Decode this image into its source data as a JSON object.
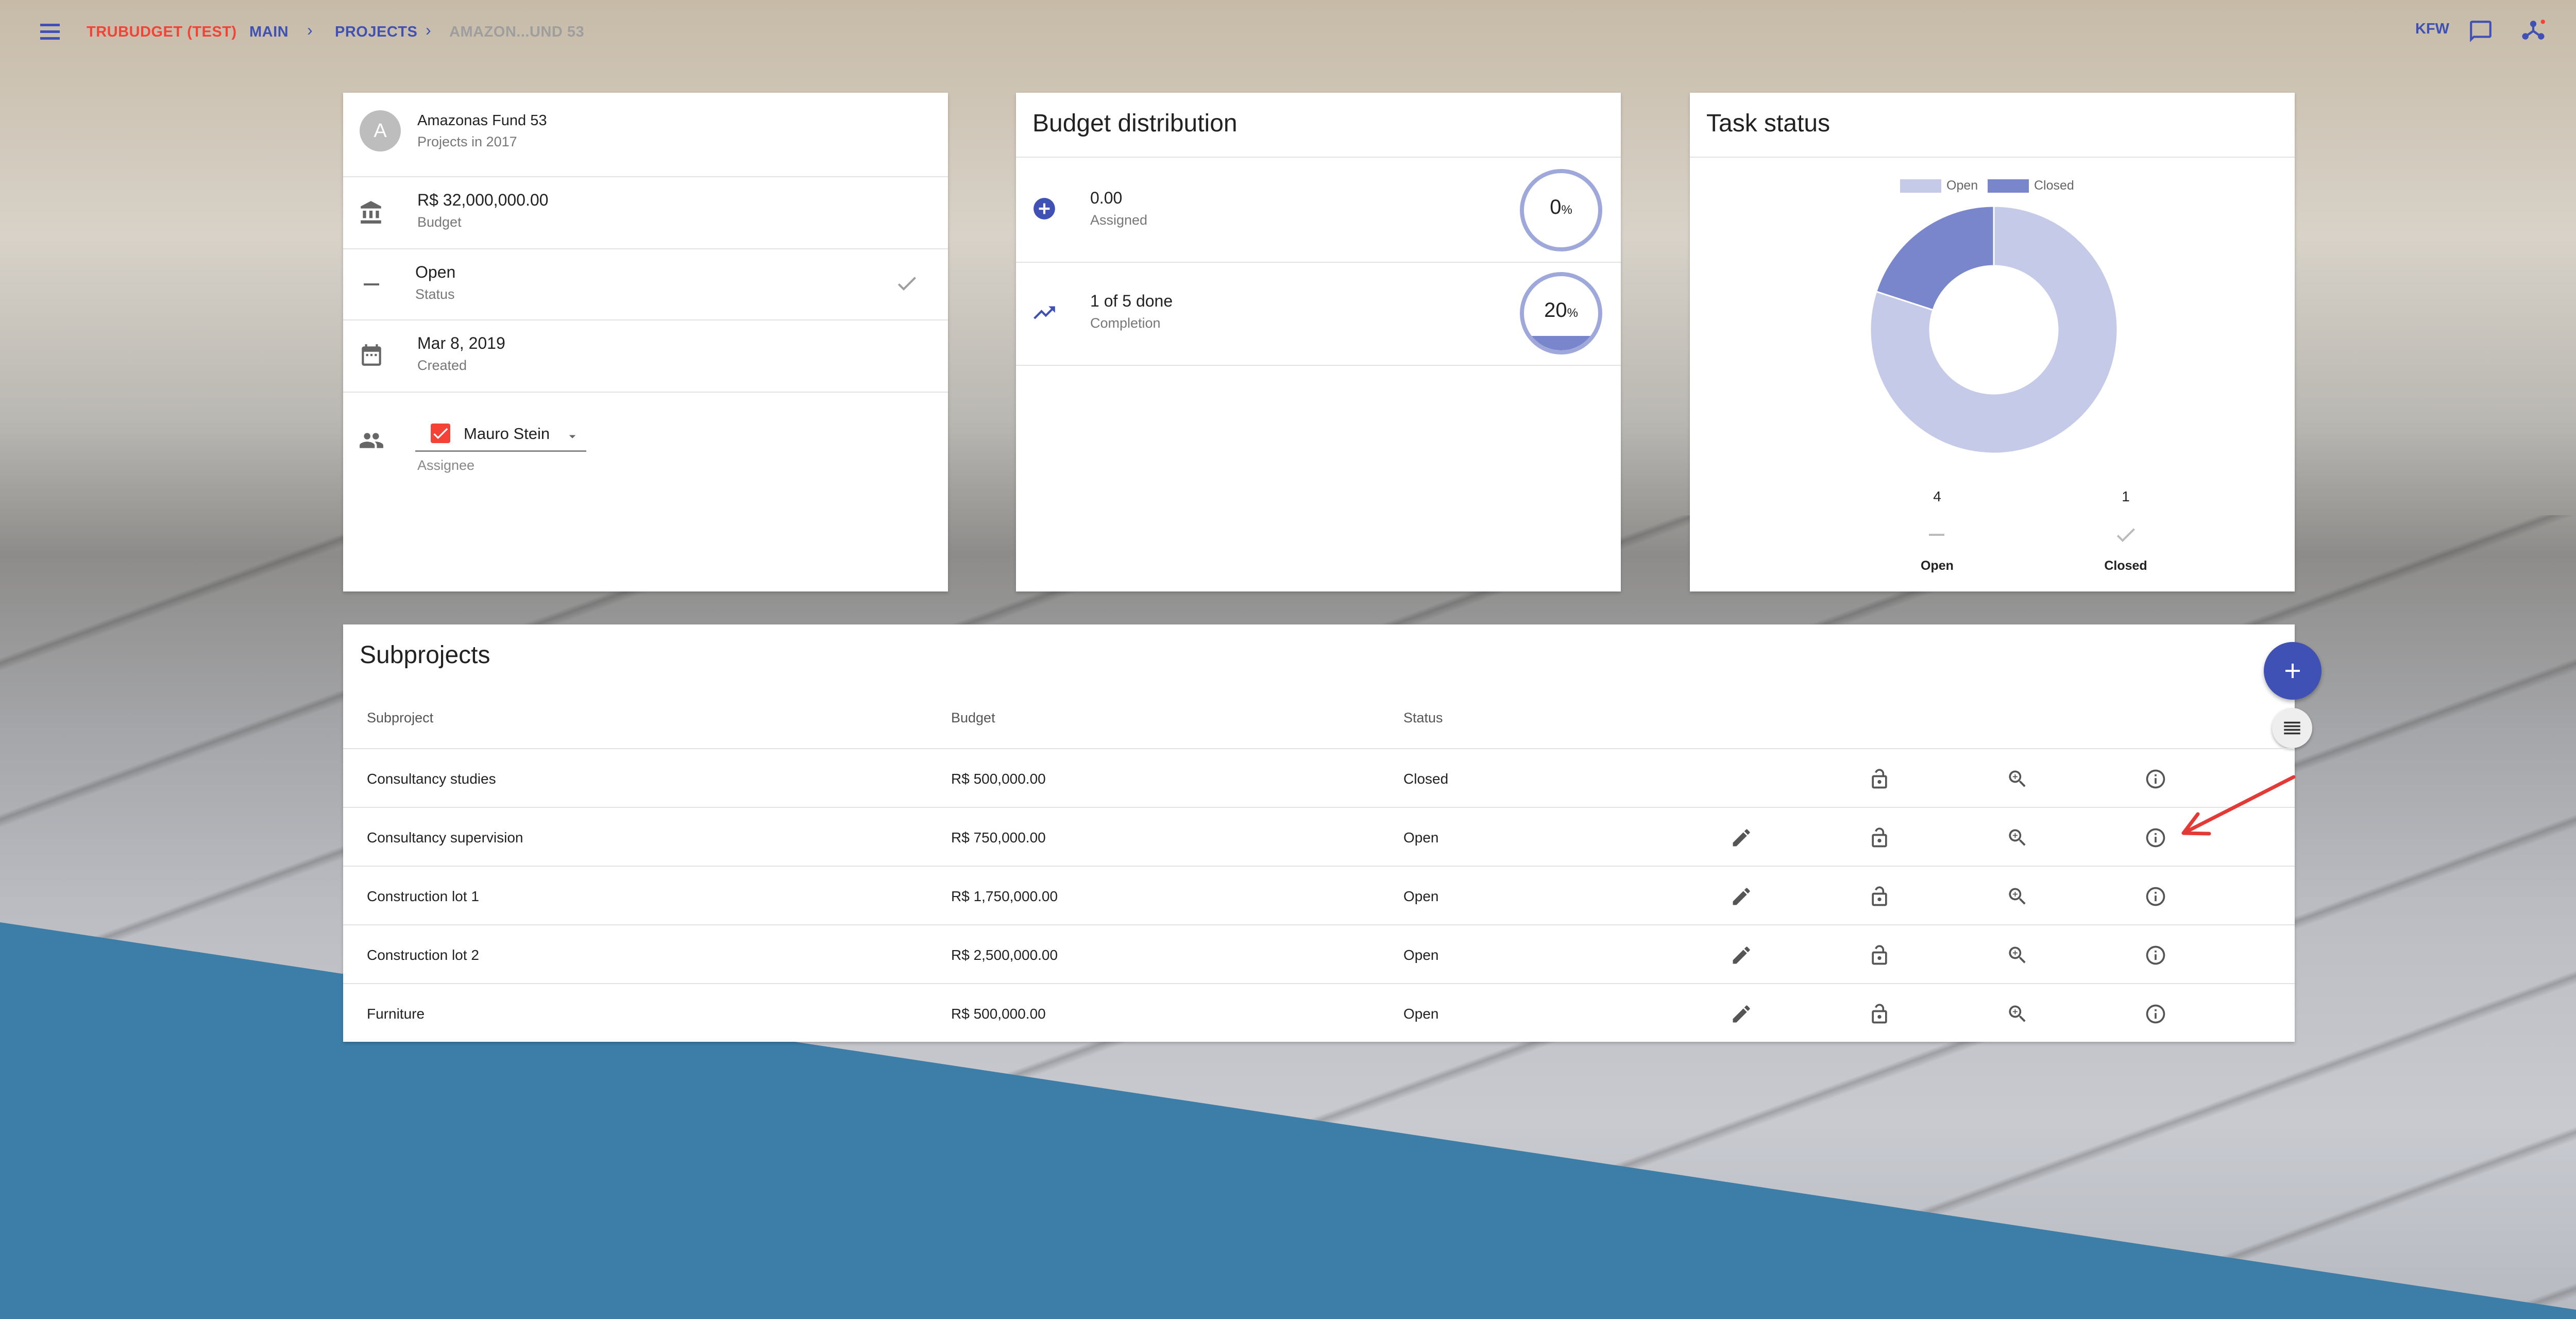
{
  "app": {
    "brand": "TRUBUDGET (TEST)",
    "breadcrumbs": [
      "MAIN",
      "PROJECTS",
      "AMAZON...UND 53"
    ],
    "user_org": "KFW",
    "colors": {
      "brand": "#f44336",
      "accent": "#3f51b5",
      "muted": "#9e9e9e"
    }
  },
  "project": {
    "avatar_letter": "A",
    "name": "Amazonas Fund 53",
    "subtitle": "Projects in 2017",
    "budget_value": "R$ 32,000,000.00",
    "budget_label": "Budget",
    "status_value": "Open",
    "status_label": "Status",
    "created_value": "Mar 8, 2019",
    "created_label": "Created",
    "assignee_value": "Mauro Stein",
    "assignee_label": "Assignee"
  },
  "budget_distribution": {
    "title": "Budget distribution",
    "assigned_value": "0.00",
    "assigned_label": "Assigned",
    "assigned_percent": "0",
    "completion_value": "1 of 5 done",
    "completion_label": "Completion",
    "completion_percent": "20",
    "percent_sign": "%"
  },
  "task_status": {
    "title": "Task status",
    "legend_open": "Open",
    "legend_closed": "Closed",
    "open_count": "4",
    "closed_count": "1",
    "open_label": "Open",
    "closed_label": "Closed"
  },
  "chart_data": {
    "type": "pie",
    "categories": [
      "Open",
      "Closed"
    ],
    "values": [
      4,
      1
    ],
    "colors": [
      "#c5cae9",
      "#7986cb"
    ],
    "legend": "top"
  },
  "subprojects": {
    "title": "Subprojects",
    "columns": [
      "Subproject",
      "Budget",
      "Status"
    ],
    "rows": [
      {
        "name": "Consultancy studies",
        "budget": "R$ 500,000.00",
        "status": "Closed",
        "editable": false
      },
      {
        "name": "Consultancy supervision",
        "budget": "R$ 750,000.00",
        "status": "Open",
        "editable": true
      },
      {
        "name": "Construction lot 1",
        "budget": "R$ 1,750,000.00",
        "status": "Open",
        "editable": true
      },
      {
        "name": "Construction lot 2",
        "budget": "R$ 2,500,000.00",
        "status": "Open",
        "editable": true
      },
      {
        "name": "Furniture",
        "budget": "R$ 500,000.00",
        "status": "Open",
        "editable": true
      }
    ]
  }
}
